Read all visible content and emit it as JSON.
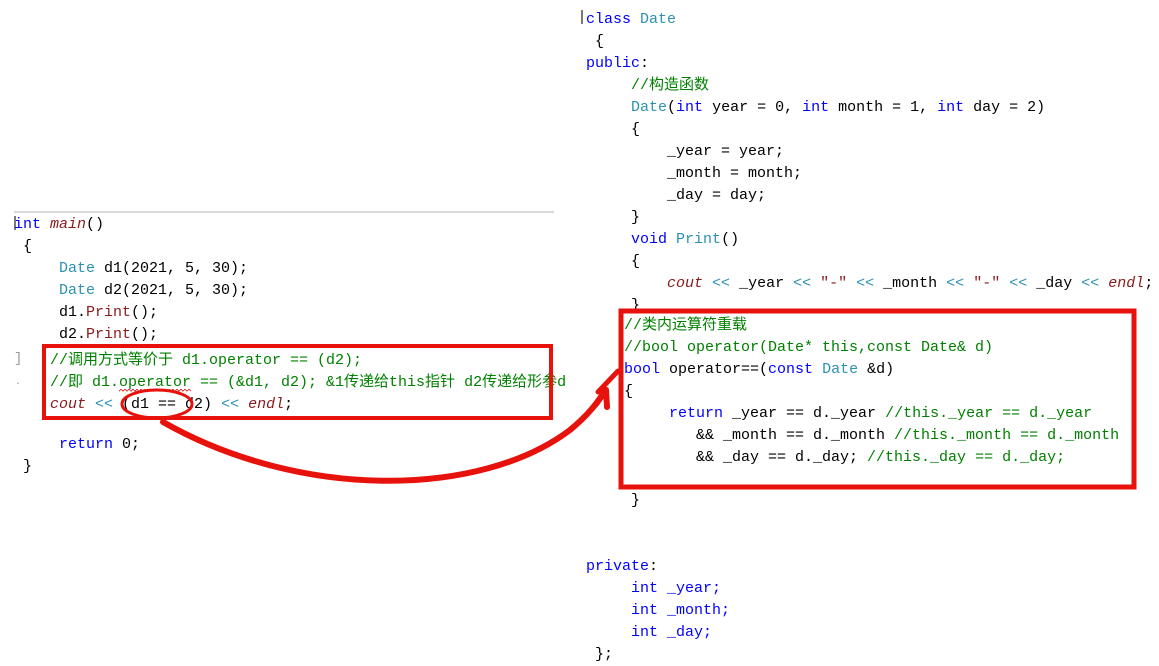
{
  "meta": {
    "accent_red": "#e8120c",
    "comment_green": "#008000",
    "keyword_blue": "#0000ff",
    "type_teal": "#2b91af",
    "function_darkred": "#8b1a1a"
  },
  "left_block": {
    "title": "main-function-code",
    "lines": [
      {
        "indent": 0,
        "tokens": [
          {
            "t": "int",
            "c": "kw"
          },
          {
            "t": " ",
            "c": "pln"
          },
          {
            "t": "main",
            "c": "fn ital"
          },
          {
            "t": "()",
            "c": "pln"
          }
        ]
      },
      {
        "indent": 0,
        "tokens": [
          {
            "t": " {",
            "c": "pln"
          }
        ]
      },
      {
        "indent": 0,
        "tokens": [
          {
            "t": "     ",
            "c": "pln"
          },
          {
            "t": "Date",
            "c": "typ"
          },
          {
            "t": " d1(2021, 5, 30);",
            "c": "pln"
          }
        ]
      },
      {
        "indent": 0,
        "tokens": [
          {
            "t": "     ",
            "c": "pln"
          },
          {
            "t": "Date",
            "c": "typ"
          },
          {
            "t": " d2(2021, 5, 30);",
            "c": "pln"
          }
        ]
      },
      {
        "indent": 0,
        "tokens": [
          {
            "t": "     d1.",
            "c": "pln"
          },
          {
            "t": "Print",
            "c": "fn"
          },
          {
            "t": "();",
            "c": "pln"
          }
        ]
      },
      {
        "indent": 0,
        "tokens": [
          {
            "t": "     d2.",
            "c": "pln"
          },
          {
            "t": "Print",
            "c": "fn"
          },
          {
            "t": "();",
            "c": "pln"
          }
        ]
      },
      {
        "indent": 0,
        "tokens": [
          {
            "t": "",
            "c": "pln"
          }
        ]
      }
    ]
  },
  "left_boxed": {
    "title": "highlighted-call-comment",
    "lines": [
      {
        "tokens": [
          {
            "t": "//调用方式等价于 d1.operator == (d2);",
            "c": "cmt"
          }
        ]
      },
      {
        "tokens": [
          {
            "t": "//即 d1.",
            "c": "cmt"
          },
          {
            "t": "operator",
            "c": "cmt squig"
          },
          {
            "t": " == (&d1, d2); &1传递给this指针 d2传递给形参d",
            "c": "cmt"
          }
        ]
      },
      {
        "tokens": [
          {
            "t": "cout",
            "c": "fn ital"
          },
          {
            "t": " ",
            "c": "pln"
          },
          {
            "t": "<<",
            "c": "op"
          },
          {
            "t": " (d1 == d2) ",
            "c": "pln"
          },
          {
            "t": "<<",
            "c": "op"
          },
          {
            "t": " ",
            "c": "pln"
          },
          {
            "t": "endl",
            "c": "fn ital"
          },
          {
            "t": ";",
            "c": "pln"
          }
        ]
      }
    ]
  },
  "left_tail": {
    "lines": [
      {
        "tokens": [
          {
            "t": "     ",
            "c": "pln"
          },
          {
            "t": "return",
            "c": "kw"
          },
          {
            "t": " 0;",
            "c": "pln"
          }
        ]
      },
      {
        "tokens": [
          {
            "t": " }",
            "c": "pln"
          }
        ]
      }
    ]
  },
  "right_block": {
    "title": "date-class-definition",
    "lines": [
      {
        "tokens": [
          {
            "t": "class",
            "c": "kw"
          },
          {
            "t": " ",
            "c": "pln"
          },
          {
            "t": "Date",
            "c": "typ"
          }
        ]
      },
      {
        "tokens": [
          {
            "t": " {",
            "c": "pln"
          }
        ]
      },
      {
        "tokens": [
          {
            "t": "public",
            "c": "kw"
          },
          {
            "t": ":",
            "c": "pln"
          }
        ]
      },
      {
        "tokens": [
          {
            "t": "     //构造函数",
            "c": "cmt"
          }
        ]
      },
      {
        "tokens": [
          {
            "t": "     ",
            "c": "pln"
          },
          {
            "t": "Date",
            "c": "typ"
          },
          {
            "t": "(",
            "c": "pln"
          },
          {
            "t": "int",
            "c": "kw"
          },
          {
            "t": " year = 0, ",
            "c": "pln"
          },
          {
            "t": "int",
            "c": "kw"
          },
          {
            "t": " month = 1, ",
            "c": "pln"
          },
          {
            "t": "int",
            "c": "kw"
          },
          {
            "t": " day = 2)",
            "c": "pln"
          }
        ]
      },
      {
        "tokens": [
          {
            "t": "     {",
            "c": "pln"
          }
        ]
      },
      {
        "tokens": [
          {
            "t": "         _year = year;",
            "c": "pln"
          }
        ]
      },
      {
        "tokens": [
          {
            "t": "         _month = month;",
            "c": "pln"
          }
        ]
      },
      {
        "tokens": [
          {
            "t": "         _day = day;",
            "c": "pln"
          }
        ]
      },
      {
        "tokens": [
          {
            "t": "     }",
            "c": "pln"
          }
        ]
      },
      {
        "tokens": [
          {
            "t": "     ",
            "c": "pln"
          },
          {
            "t": "void",
            "c": "kw"
          },
          {
            "t": " ",
            "c": "pln"
          },
          {
            "t": "Print",
            "c": "typ"
          },
          {
            "t": "()",
            "c": "pln"
          }
        ]
      },
      {
        "tokens": [
          {
            "t": "     {",
            "c": "pln"
          }
        ]
      },
      {
        "tokens": [
          {
            "t": "         ",
            "c": "pln"
          },
          {
            "t": "cout",
            "c": "fn ital"
          },
          {
            "t": " ",
            "c": "pln"
          },
          {
            "t": "<<",
            "c": "op"
          },
          {
            "t": " _year ",
            "c": "pln"
          },
          {
            "t": "<<",
            "c": "op"
          },
          {
            "t": " ",
            "c": "pln"
          },
          {
            "t": "\"-\"",
            "c": "str"
          },
          {
            "t": " ",
            "c": "pln"
          },
          {
            "t": "<<",
            "c": "op"
          },
          {
            "t": " _month ",
            "c": "pln"
          },
          {
            "t": "<<",
            "c": "op"
          },
          {
            "t": " ",
            "c": "pln"
          },
          {
            "t": "\"-\"",
            "c": "str"
          },
          {
            "t": " ",
            "c": "pln"
          },
          {
            "t": "<<",
            "c": "op"
          },
          {
            "t": " _day ",
            "c": "pln"
          },
          {
            "t": "<<",
            "c": "op"
          },
          {
            "t": " ",
            "c": "pln"
          },
          {
            "t": "endl",
            "c": "fn ital"
          },
          {
            "t": ";",
            "c": "pln"
          }
        ]
      },
      {
        "tokens": [
          {
            "t": "     }",
            "c": "pln"
          }
        ]
      }
    ]
  },
  "right_boxed": {
    "title": "operator-overload-block",
    "lines": [
      {
        "tokens": [
          {
            "t": "//类内运算符重载",
            "c": "cmt"
          }
        ]
      },
      {
        "tokens": [
          {
            "t": "//bool operator(Date* this,const Date& d)",
            "c": "cmt"
          }
        ]
      },
      {
        "tokens": [
          {
            "t": "bool",
            "c": "kw"
          },
          {
            "t": " operator==(",
            "c": "pln"
          },
          {
            "t": "const",
            "c": "kw"
          },
          {
            "t": " ",
            "c": "pln"
          },
          {
            "t": "Date",
            "c": "typ"
          },
          {
            "t": " &d)",
            "c": "pln"
          }
        ]
      },
      {
        "tokens": [
          {
            "t": "{",
            "c": "pln"
          }
        ]
      },
      {
        "tokens": [
          {
            "t": "     ",
            "c": "pln"
          },
          {
            "t": "return",
            "c": "kw"
          },
          {
            "t": " _year == d._year ",
            "c": "pln"
          },
          {
            "t": "//this._year == d._year",
            "c": "cmt"
          }
        ]
      },
      {
        "tokens": [
          {
            "t": "        && _month == d._month ",
            "c": "pln"
          },
          {
            "t": "//this._month == d._month",
            "c": "cmt"
          }
        ]
      },
      {
        "tokens": [
          {
            "t": "        && _day == d._day; ",
            "c": "pln"
          },
          {
            "t": "//this._day == d._day;",
            "c": "cmt"
          }
        ]
      }
    ]
  },
  "right_tail": {
    "lines": [
      {
        "tokens": [
          {
            "t": "     }",
            "c": "pln"
          }
        ]
      },
      {
        "tokens": [
          {
            "t": "",
            "c": "pln"
          }
        ]
      },
      {
        "tokens": [
          {
            "t": "",
            "c": "pln"
          }
        ]
      },
      {
        "tokens": [
          {
            "t": "private",
            "c": "kw"
          },
          {
            "t": ":",
            "c": "pln"
          }
        ]
      },
      {
        "tokens": [
          {
            "t": "     ",
            "c": "pln"
          },
          {
            "t": "int",
            "c": "kw"
          },
          {
            "t": " ",
            "c": "kw"
          },
          {
            "t": "_year;",
            "c": "kw"
          }
        ]
      },
      {
        "tokens": [
          {
            "t": "     ",
            "c": "pln"
          },
          {
            "t": "int",
            "c": "kw"
          },
          {
            "t": " ",
            "c": "kw"
          },
          {
            "t": "_month;",
            "c": "kw"
          }
        ]
      },
      {
        "tokens": [
          {
            "t": "     ",
            "c": "pln"
          },
          {
            "t": "int",
            "c": "kw"
          },
          {
            "t": " ",
            "c": "kw"
          },
          {
            "t": "_day;",
            "c": "kw"
          }
        ]
      },
      {
        "tokens": [
          {
            "t": " };",
            "c": "pln"
          }
        ]
      }
    ]
  },
  "annotations": {
    "left_box_label": "red-highlight-box-left",
    "right_box_label": "red-highlight-box-right",
    "ellipse_label": "red-ellipse-d1-eq-d2",
    "arrow_label": "red-curved-arrow",
    "small_arrow_label": "red-small-arrow"
  }
}
